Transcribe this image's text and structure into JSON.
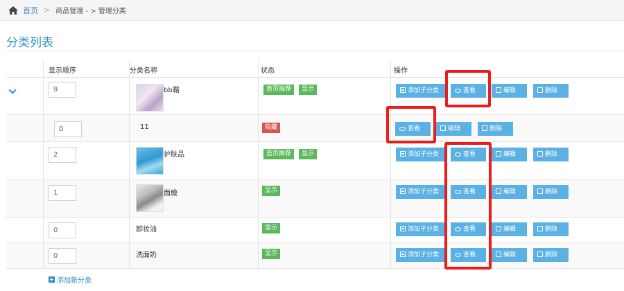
{
  "breadcrumb": {
    "home": "首页",
    "path": "商品管理 - > 管理分类"
  },
  "page_title": "分类列表",
  "table": {
    "headers": {
      "order": "显示顺序",
      "name": "分类名称",
      "status": "状态",
      "ops": "操作"
    },
    "rows": [
      {
        "order": "9",
        "name": "bb霜",
        "tags": [
          "首页推荐",
          "显示"
        ],
        "tag_style": [
          "green",
          "green"
        ]
      },
      {
        "order": "0",
        "name": "11",
        "tags": [
          "隐藏"
        ],
        "tag_style": [
          "red"
        ]
      },
      {
        "order": "2",
        "name": "护肤品",
        "tags": [
          "首页推荐",
          "显示"
        ],
        "tag_style": [
          "green",
          "green"
        ]
      },
      {
        "order": "1",
        "name": "面膜",
        "tags": [
          "显示"
        ],
        "tag_style": [
          "green"
        ]
      },
      {
        "order": "0",
        "name": "卸妆油",
        "tags": [
          "显示"
        ],
        "tag_style": [
          "green"
        ]
      },
      {
        "order": "0",
        "name": "洗面奶",
        "tags": [
          "显示"
        ],
        "tag_style": [
          "green"
        ]
      }
    ]
  },
  "buttons": {
    "add_child": "添加子分类",
    "view": "查看",
    "edit": "编辑",
    "delete": "删除"
  },
  "add_new": "添加新分类",
  "colors": {
    "accent": "#2f8fc6",
    "button": "#5bb1e3",
    "tag_green": "#5cb85c",
    "tag_red": "#d9534f",
    "highlight": "#ea1c1c"
  }
}
